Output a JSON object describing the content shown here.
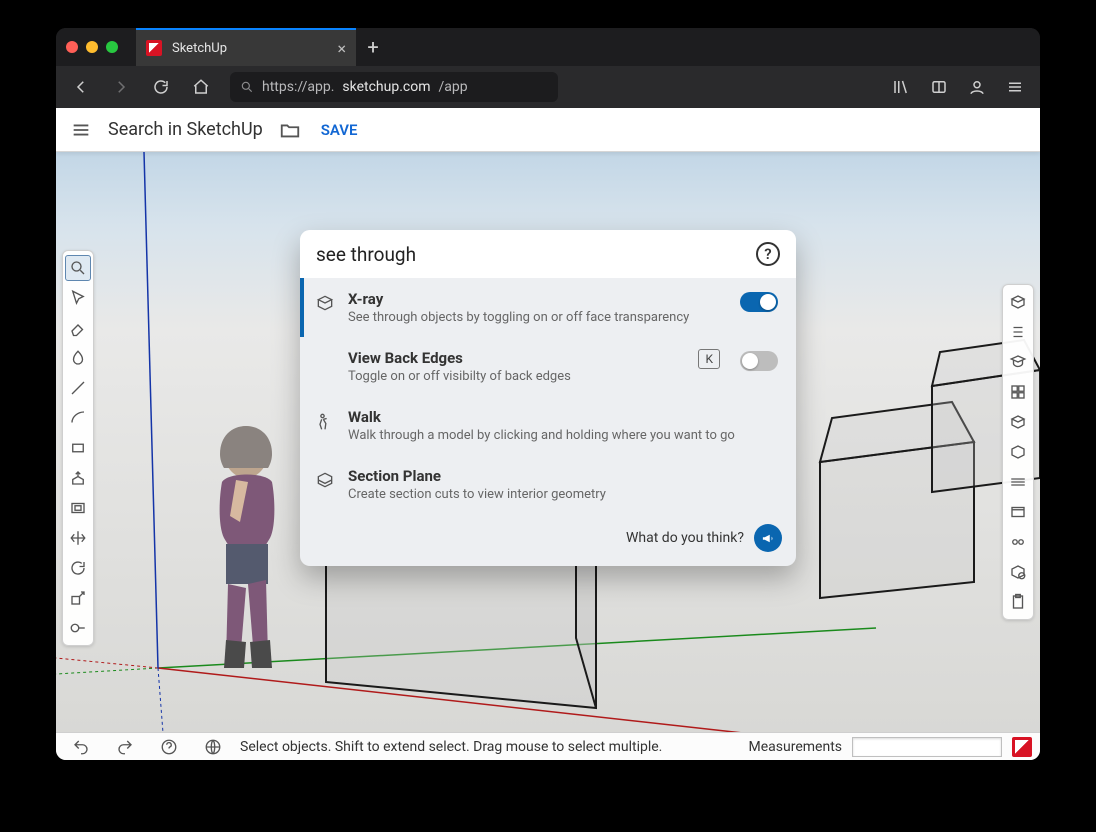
{
  "browser": {
    "tab_title": "SketchUp",
    "url_prefix": "https://app.",
    "url_host": "sketchup.com",
    "url_suffix": "/app"
  },
  "app": {
    "search_title": "Search in SketchUp",
    "save_label": "SAVE"
  },
  "popup": {
    "query": "see through",
    "feedback_prompt": "What do you think?",
    "results": [
      {
        "title": "X-ray",
        "desc": "See through objects by toggling on or off face transparency",
        "toggle": "on"
      },
      {
        "title": "View Back Edges",
        "desc": "Toggle on or off visibilty of back edges",
        "shortcut": "K",
        "toggle": "off"
      },
      {
        "title": "Walk",
        "desc": "Walk through a model by clicking and holding where you want to go"
      },
      {
        "title": "Section Plane",
        "desc": "Create section cuts to view interior geometry"
      }
    ]
  },
  "status": {
    "hint": "Select objects. Shift to extend select. Drag mouse to select multiple.",
    "measurements_label": "Measurements",
    "measurements_value": ""
  }
}
